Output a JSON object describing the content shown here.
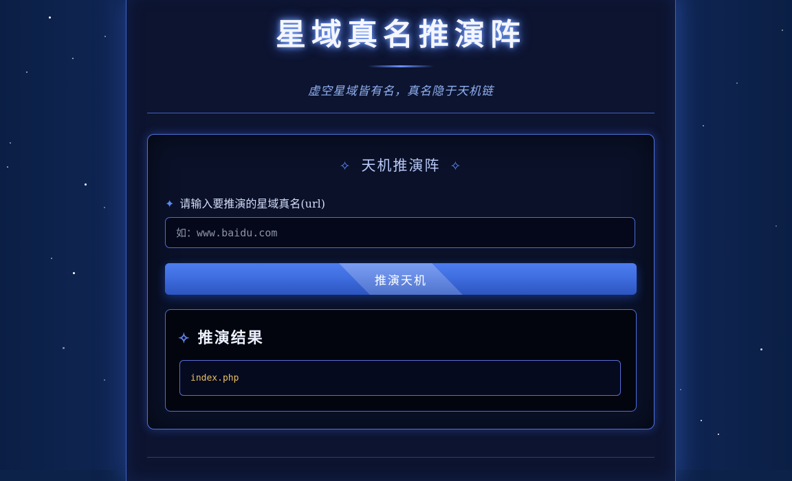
{
  "header": {
    "title": "星域真名推演阵",
    "subtitle": "虚空星域皆有名，真名隐于天机链"
  },
  "form_card": {
    "title": "天机推演阵",
    "title_decoration": "✧",
    "field_label": "请输入要推演的星域真名(url)",
    "field_label_decoration": "✦",
    "input_placeholder": "如：www.baidu.com",
    "input_value": "",
    "submit_label": "推演天机"
  },
  "result": {
    "heading": "推演结果",
    "heading_decoration": "✧",
    "value": "index.php"
  },
  "colors": {
    "page_background": "#0d2249",
    "panel_background": "#0d1430",
    "accent_blue": "#4e72dd",
    "button_blue": "#3f6ee0",
    "result_text": "#e8c060"
  }
}
